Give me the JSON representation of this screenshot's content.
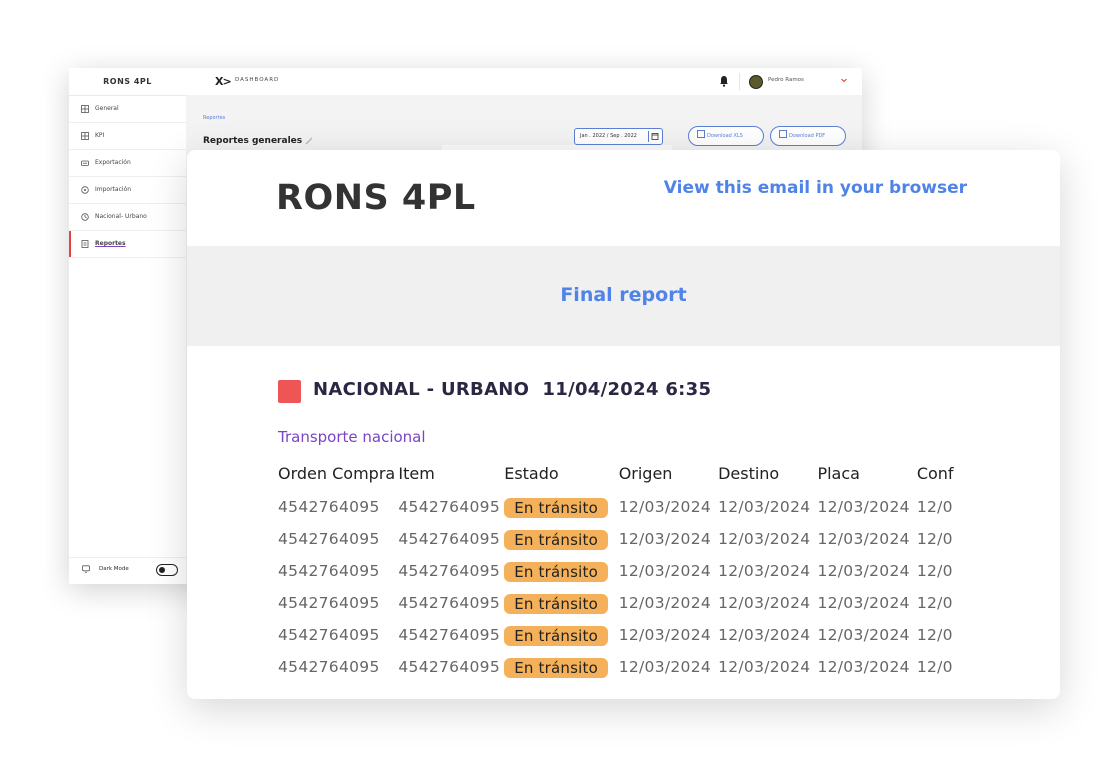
{
  "dashboard": {
    "brand": "RONS 4PL",
    "logo_glyph": "X>",
    "title": "DASHBOARD",
    "user_name": "Pedro Ramos",
    "breadcrumb": "Reportes",
    "page_title": "Reportes generales",
    "date_range": "Jan . 2022 / Sep . 2022",
    "download_xls": "Download XLS",
    "download_pdf": "Download PDF",
    "dark_mode_label": "Dark Mode",
    "dark_mode_on": false,
    "sidebar": {
      "items": [
        {
          "label": "General",
          "icon": "grid-icon",
          "active": false
        },
        {
          "label": "KPI",
          "icon": "grid-icon",
          "active": false
        },
        {
          "label": "Exportación",
          "icon": "export-icon",
          "active": false
        },
        {
          "label": "Importación",
          "icon": "import-icon",
          "active": false
        },
        {
          "label": "Nacional- Urbano",
          "icon": "clock-icon",
          "active": false
        },
        {
          "label": "Reportes",
          "icon": "report-icon",
          "active": true
        }
      ]
    },
    "colors": {
      "accent": "#5a7fd6",
      "active_marker": "#e84040"
    }
  },
  "email": {
    "brand": "RONS 4PL",
    "view_in_browser": "View this email in your browser",
    "report_title": "Final report",
    "section": {
      "title": "NACIONAL - URBANO",
      "datetime": "11/04/2024 6:35",
      "subtitle": "Transporte nacional",
      "marker_color": "#ee5656"
    },
    "table": {
      "headers": [
        "Orden Compra",
        "Item",
        "Estado",
        "Origen",
        "Destino",
        "Placa",
        "Conf"
      ],
      "rows": [
        {
          "orden": "4542764095",
          "item": "4542764095",
          "estado": "En tránsito",
          "origen": "12/03/2024",
          "destino": "12/03/2024",
          "placa": "12/03/2024",
          "conf": "12/0"
        },
        {
          "orden": "4542764095",
          "item": "4542764095",
          "estado": "En tránsito",
          "origen": "12/03/2024",
          "destino": "12/03/2024",
          "placa": "12/03/2024",
          "conf": "12/0"
        },
        {
          "orden": "4542764095",
          "item": "4542764095",
          "estado": "En tránsito",
          "origen": "12/03/2024",
          "destino": "12/03/2024",
          "placa": "12/03/2024",
          "conf": "12/0"
        },
        {
          "orden": "4542764095",
          "item": "4542764095",
          "estado": "En tránsito",
          "origen": "12/03/2024",
          "destino": "12/03/2024",
          "placa": "12/03/2024",
          "conf": "12/0"
        },
        {
          "orden": "4542764095",
          "item": "4542764095",
          "estado": "En tránsito",
          "origen": "12/03/2024",
          "destino": "12/03/2024",
          "placa": "12/03/2024",
          "conf": "12/0"
        },
        {
          "orden": "4542764095",
          "item": "4542764095",
          "estado": "En tránsito",
          "origen": "12/03/2024",
          "destino": "12/03/2024",
          "placa": "12/03/2024",
          "conf": "12/0"
        }
      ]
    },
    "colors": {
      "link": "#4f83e8",
      "badge": "#f5b159",
      "subtitle": "#7a44c4"
    }
  }
}
